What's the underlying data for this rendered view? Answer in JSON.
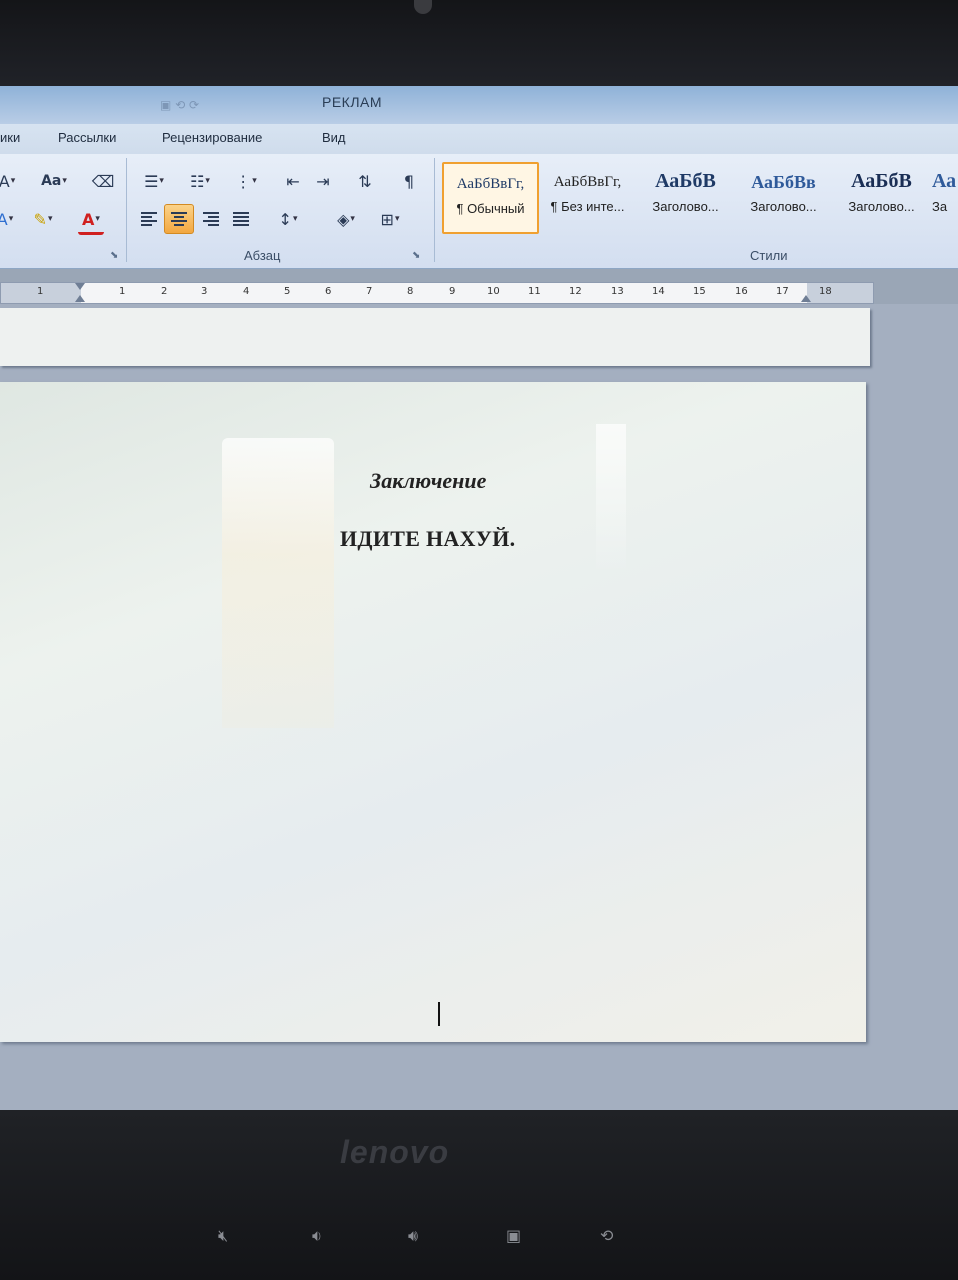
{
  "window": {
    "title": "РЕКЛАМ"
  },
  "menu": {
    "tabs": [
      "ики",
      "Рассылки",
      "Рецензирование",
      "Вид"
    ]
  },
  "ribbon": {
    "groups": {
      "paragraph_label": "Абзац",
      "styles_label": "Стили"
    },
    "font_buttons": {
      "change_case": "Aa"
    },
    "styles": [
      {
        "sample": "АаБбВвГг,",
        "name": "¶ Обычный",
        "selected": true
      },
      {
        "sample": "АаБбВвГг,",
        "name": "¶ Без инте..."
      },
      {
        "sample": "АаБбВ",
        "name": "Заголово..."
      },
      {
        "sample": "АаБбВв",
        "name": "Заголово..."
      },
      {
        "sample": "АаБбВ",
        "name": "Заголово..."
      },
      {
        "sample": "Аа",
        "name": "За"
      }
    ]
  },
  "ruler": {
    "numbers": [
      "1",
      "1",
      "2",
      "3",
      "4",
      "5",
      "6",
      "7",
      "8",
      "9",
      "10",
      "11",
      "12",
      "13",
      "14",
      "15",
      "16",
      "17",
      "18"
    ]
  },
  "document": {
    "heading": "Заключение",
    "body": "ИДИТЕ НАХУЙ."
  },
  "laptop": {
    "brand": "lenovo"
  },
  "colors": {
    "ribbon_bg": "#dbe5f2",
    "active_button": "#f2a740",
    "style_heading": "#1f3a66"
  }
}
